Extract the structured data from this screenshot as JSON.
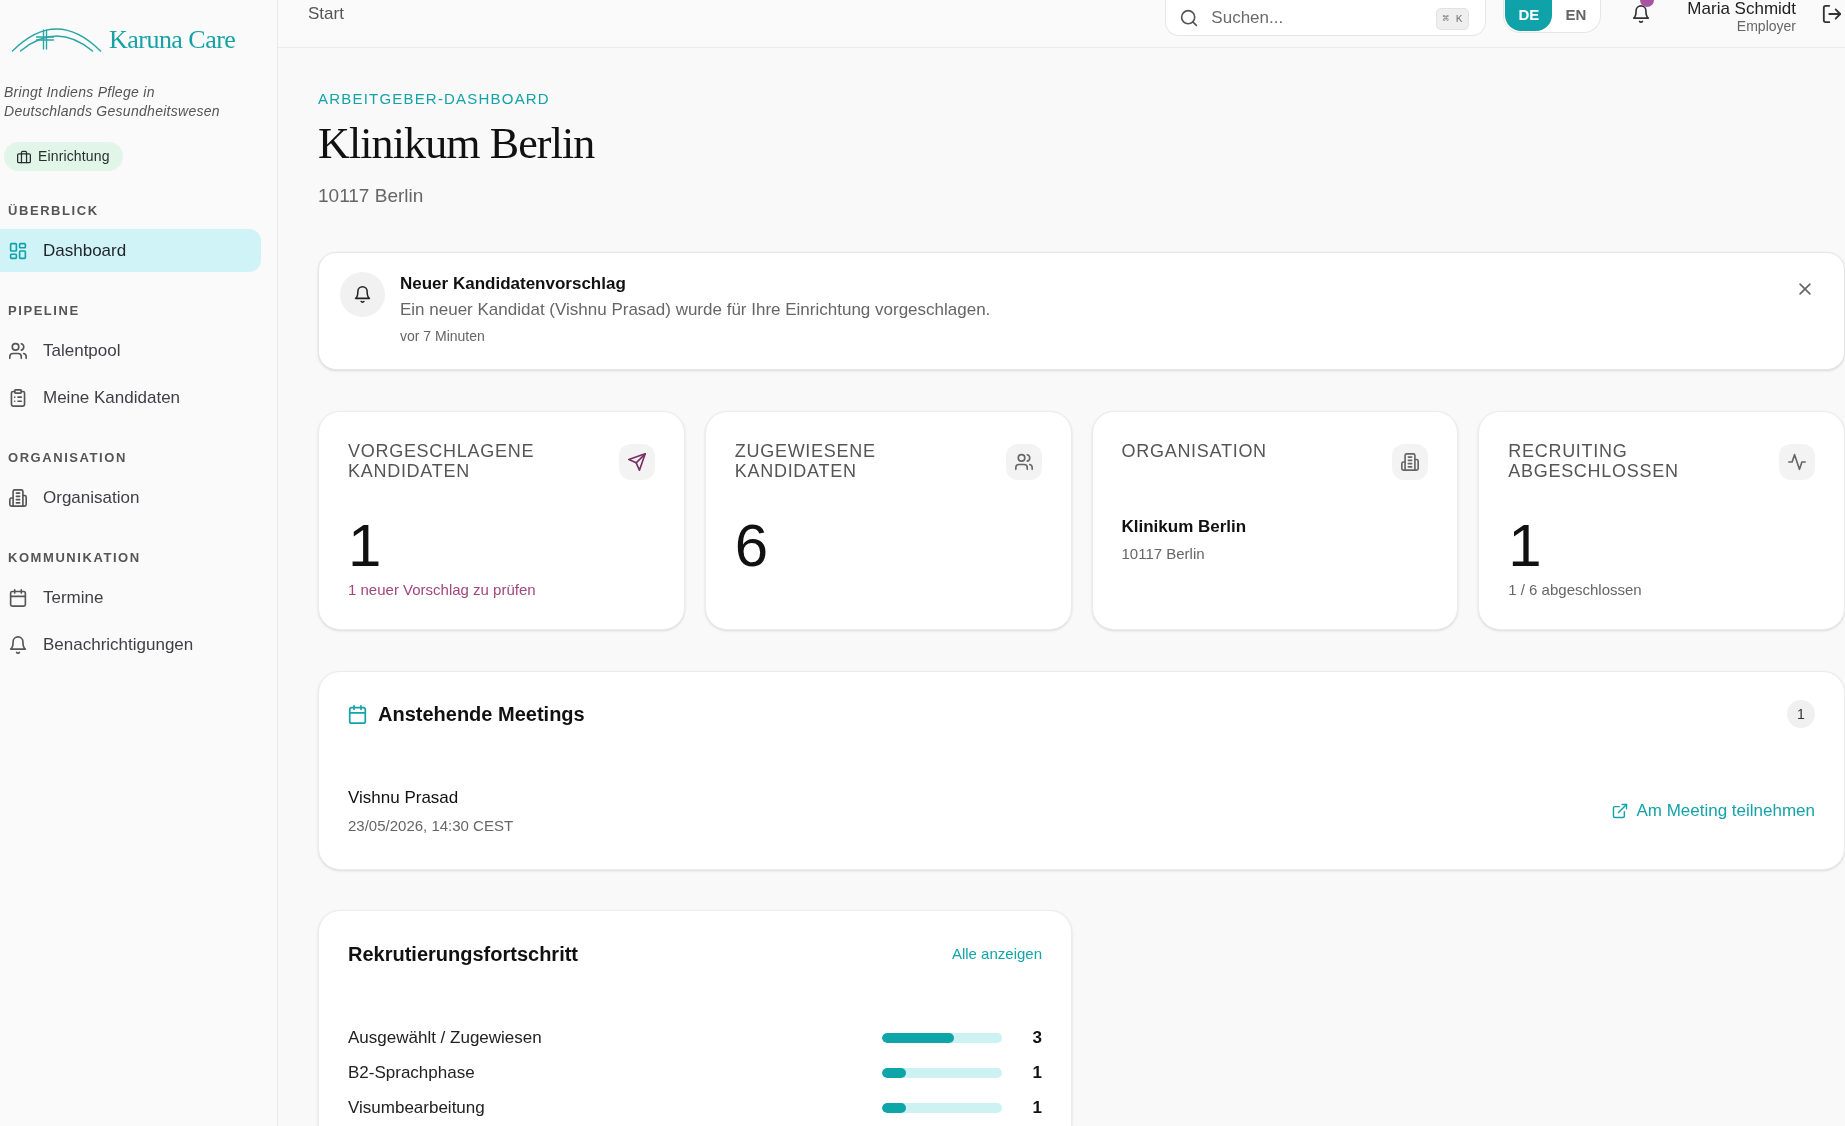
{
  "sidebar": {
    "brand": "Karuna Care",
    "tagline": "Bringt Indiens Pflege in Deutschlands Gesundheitswesen",
    "role_badge": "Einrichtung",
    "sections": [
      {
        "title": "ÜBERBLICK",
        "items": [
          {
            "label": "Dashboard",
            "selected": true
          }
        ]
      },
      {
        "title": "PIPELINE",
        "items": [
          {
            "label": "Talentpool",
            "selected": false
          },
          {
            "label": "Meine Kandidaten",
            "selected": false
          }
        ]
      },
      {
        "title": "ORGANISATION",
        "items": [
          {
            "label": "Organisation",
            "selected": false
          }
        ]
      },
      {
        "title": "KOMMUNIKATION",
        "items": [
          {
            "label": "Termine",
            "selected": false
          },
          {
            "label": "Benachrichtigungen",
            "selected": false
          }
        ]
      }
    ]
  },
  "header": {
    "breadcrumb": "Start",
    "search": {
      "placeholder": "Suchen...",
      "shortcut": "⌘ K"
    },
    "languages": [
      {
        "label": "DE",
        "selected": true
      },
      {
        "label": "EN",
        "selected": false
      }
    ],
    "notifications": {
      "unread": true
    },
    "user": {
      "name": "Maria Schmidt",
      "role": "Employer"
    }
  },
  "page": {
    "eyebrow": "ARBEITGEBER-DASHBOARD",
    "title": "Klinikum Berlin",
    "subtitle": "10117 Berlin"
  },
  "notice": {
    "title": "Neuer Kandidatenvorschlag",
    "message": "Ein neuer Kandidat (Vishnu Prasad) wurde für Ihre Einrichtung vorgeschlagen.",
    "time": "vor 7 Minuten"
  },
  "stats": [
    {
      "kind": "metric",
      "label": "VORGESCHLAGENE KANDIDATEN",
      "value": "1",
      "note": "1 neuer Vorschlag zu prüfen",
      "highlighted": true
    },
    {
      "kind": "metric",
      "label": "ZUGEWIESENE KANDIDATEN",
      "value": "6",
      "highlighted": false
    },
    {
      "kind": "organization",
      "label": "ORGANISATION",
      "name": "Klinikum Berlin",
      "address": "10117 Berlin",
      "highlighted": false
    },
    {
      "kind": "metric",
      "label": "RECRUITING ABGESCHLOSSEN",
      "value": "1",
      "note": "1 / 6 abgeschlossen",
      "highlighted": false
    }
  ],
  "meetings": {
    "title": "Anstehende Meetings",
    "count": "1",
    "items": [
      {
        "name": "Vishnu Prasad",
        "datetime": "23/05/2026, 14:30 CEST",
        "action": "Am Meeting teilnehmen"
      }
    ]
  },
  "progress": {
    "title": "Rekrutierungsfortschritt",
    "link": "Alle anzeigen",
    "rows": [
      {
        "label": "Ausgewählt / Zugewiesen",
        "level": 0.6,
        "count": "3"
      },
      {
        "label": "B2-Sprachphase",
        "level": 0.2,
        "count": "1"
      },
      {
        "label": "Visumbearbeitung",
        "level": 0.2,
        "count": "1"
      }
    ]
  }
}
